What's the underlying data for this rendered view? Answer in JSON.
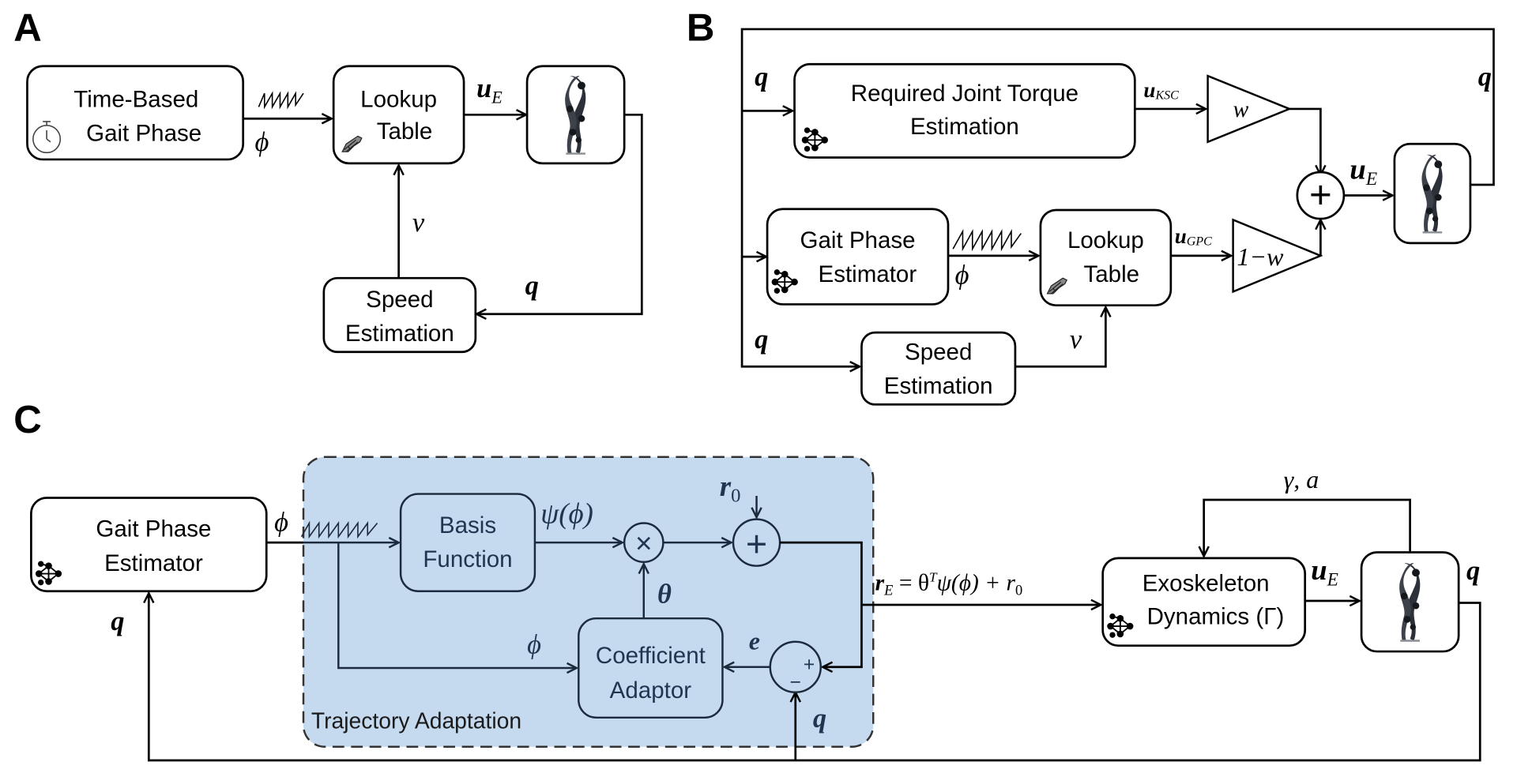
{
  "figure": {
    "panels": {
      "A": {
        "label": "A",
        "blocks": {
          "time_based_line1": "Time-Based",
          "time_based_line2": "Gait Phase",
          "lookup_line1": "Lookup",
          "lookup_line2": "Table",
          "speed_line1": "Speed",
          "speed_line2": "Estimation"
        },
        "signals": {
          "phase": "ϕ",
          "control": "u",
          "control_sub": "E",
          "speed": "v",
          "joint": "q"
        }
      },
      "B": {
        "label": "B",
        "blocks": {
          "torque_line1": "Required Joint Torque",
          "torque_line2": "Estimation",
          "gait_line1": "Gait Phase",
          "gait_line2": "Estimator",
          "lookup_line1": "Lookup",
          "lookup_line2": "Table",
          "speed_line1": "Speed",
          "speed_line2": "Estimation"
        },
        "gains": {
          "w": "w",
          "one_minus_w": "1−w"
        },
        "summer": "+",
        "signals": {
          "joint": "q",
          "u_ksc": "u",
          "u_ksc_sub": "KSC",
          "u_gpc": "u",
          "u_gpc_sub": "GPC",
          "phase": "ϕ",
          "speed": "v",
          "control": "u",
          "control_sub": "E"
        }
      },
      "C": {
        "label": "C",
        "region_label": "Trajectory Adaptation",
        "blocks": {
          "gait_line1": "Gait Phase",
          "gait_line2": "Estimator",
          "basis_line1": "Basis",
          "basis_line2": "Function",
          "coef_line1": "Coefficient",
          "coef_line2": "Adaptor",
          "exo_line1": "Exoskeleton",
          "exo_line2": "Dynamics (Γ)"
        },
        "operators": {
          "multiply": "×",
          "add": "+",
          "sub_plus": "+",
          "sub_minus": "−"
        },
        "signals": {
          "phase": "ϕ",
          "psi": "ψ(ϕ)",
          "r0": "r",
          "r0_sub": "0",
          "theta": "θ",
          "error": "e",
          "joint": "q",
          "reference": "r",
          "reference_sub": "E",
          "reference_eq": " = θ",
          "reference_sup": "T",
          "reference_eq2": "ψ(ϕ) + r",
          "reference_eq2_sub": "0",
          "gamma_a": "γ, a",
          "control": "u",
          "control_sub": "E"
        }
      }
    }
  }
}
